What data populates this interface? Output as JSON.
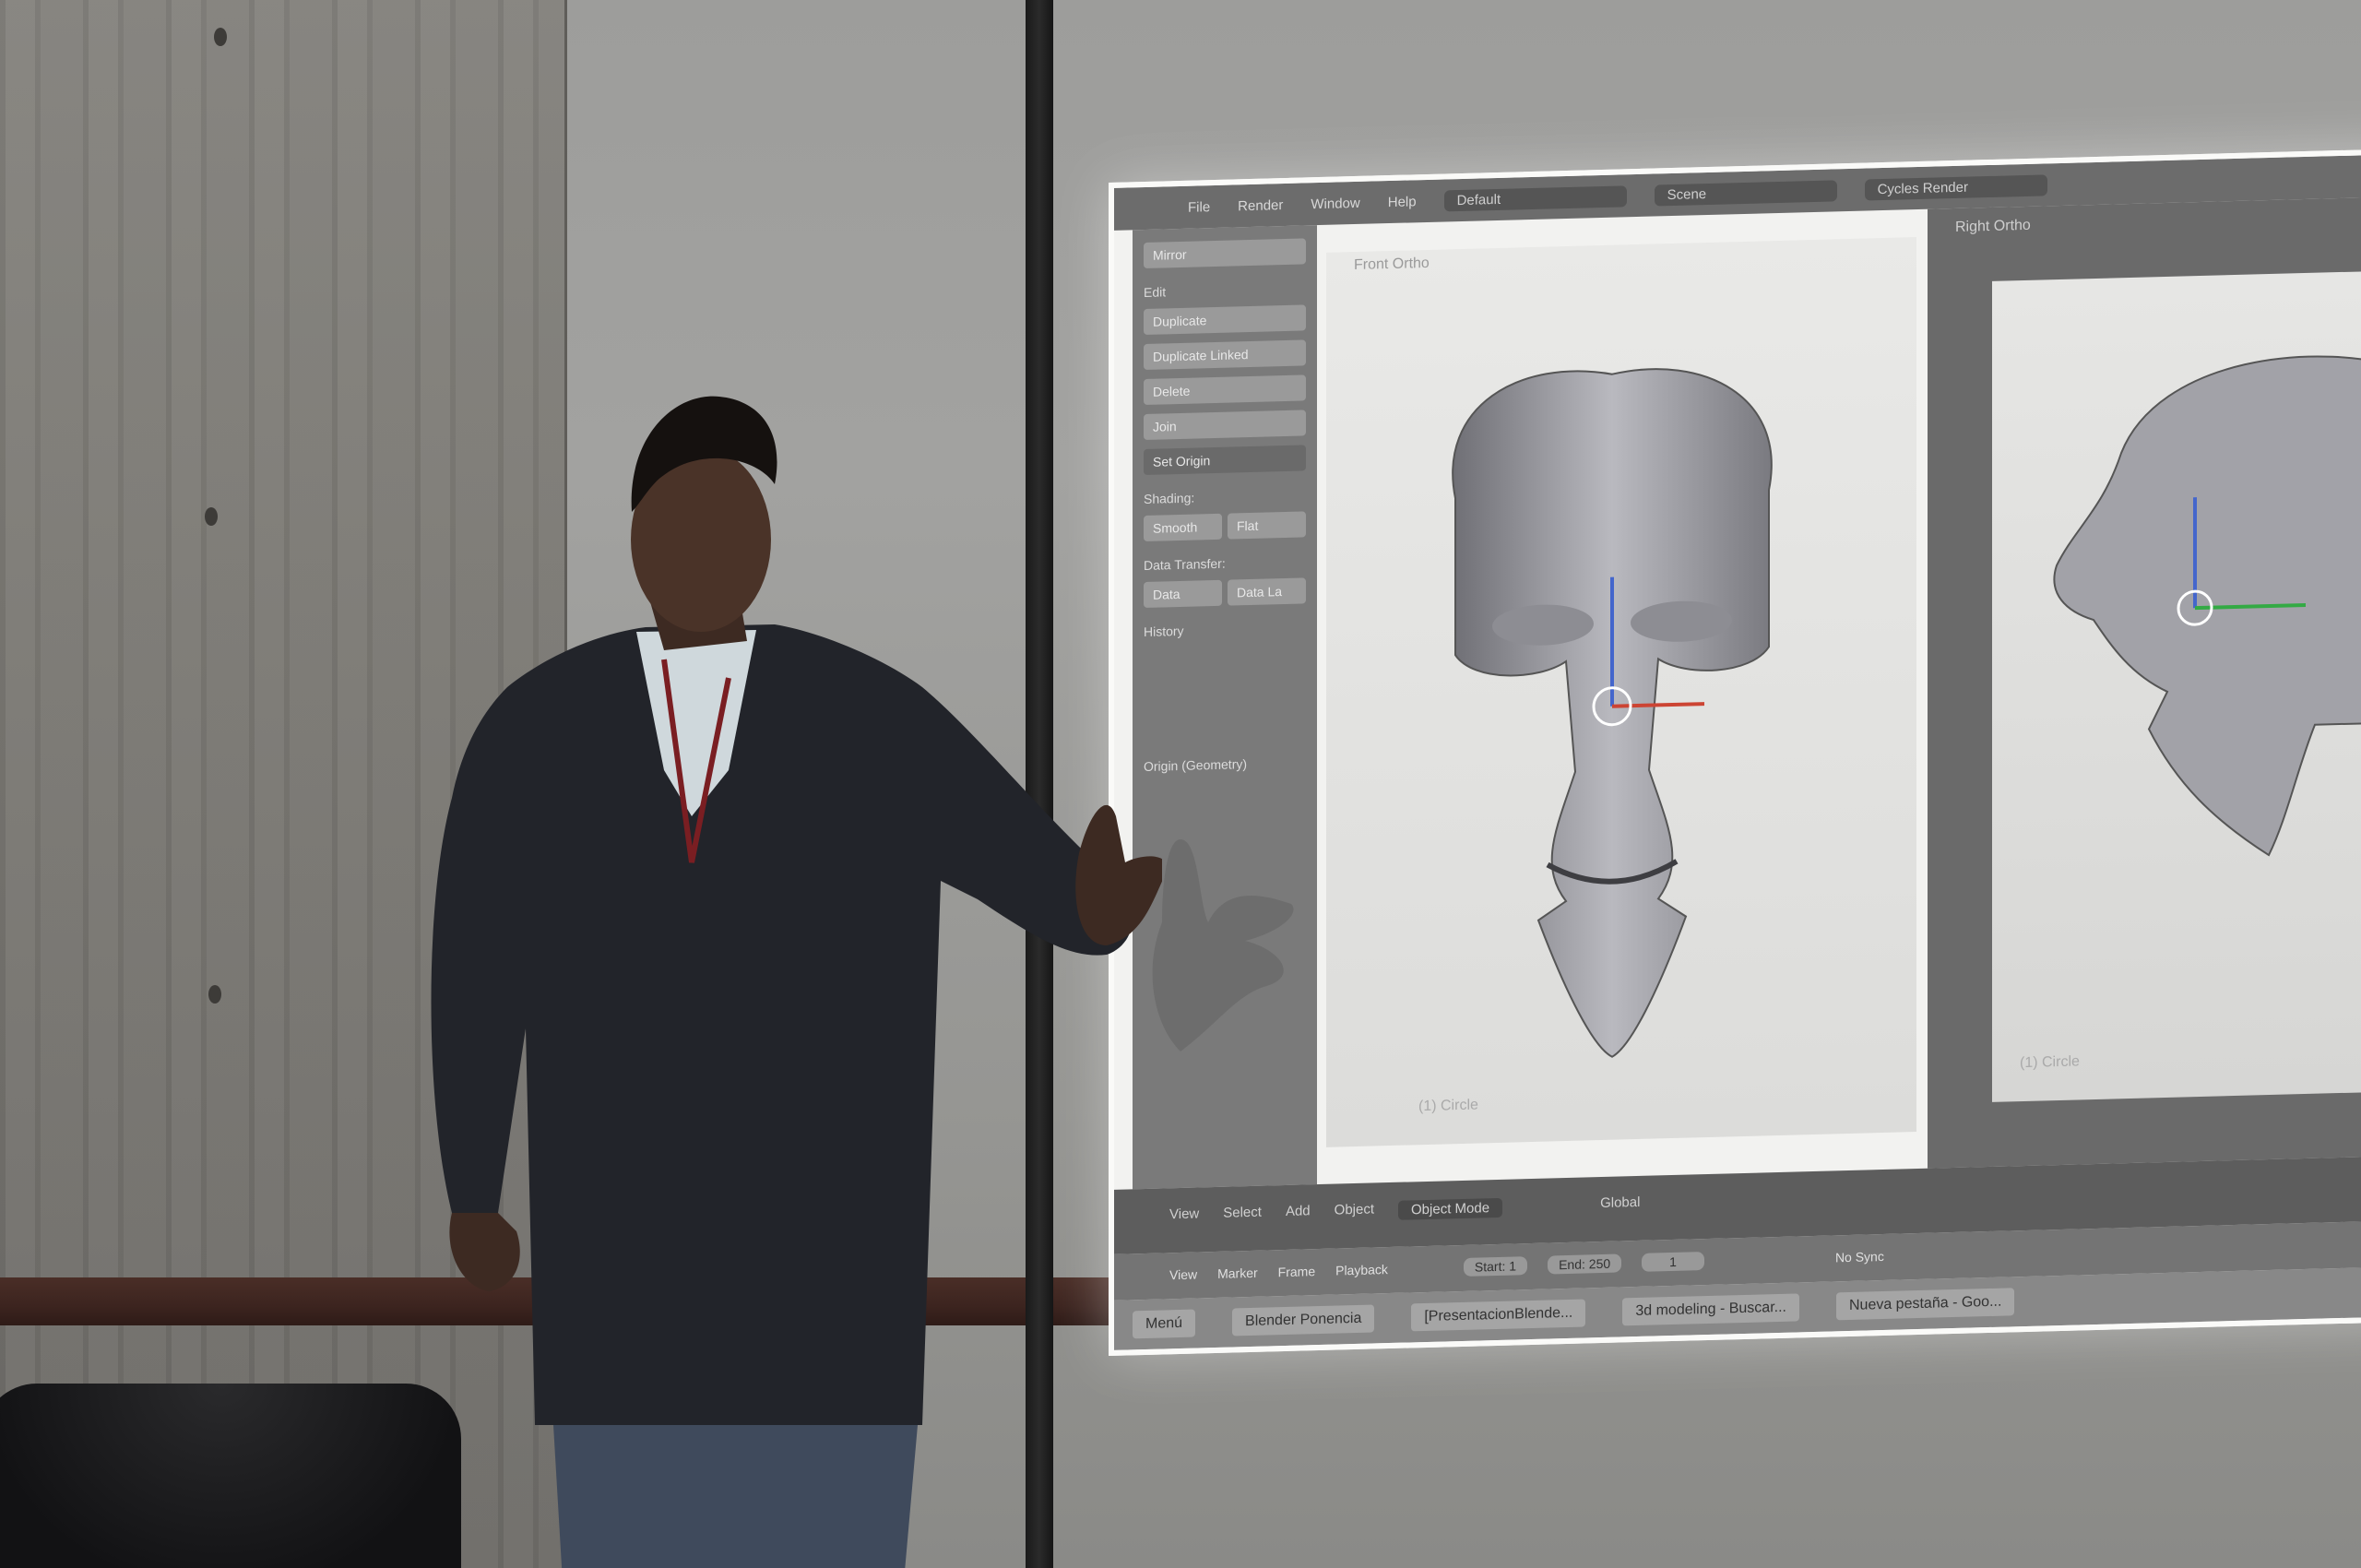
{
  "screen": {
    "menubar": {
      "items": [
        "File",
        "Render",
        "Window",
        "Help"
      ],
      "layout_field": "Default",
      "scene_field": "Scene",
      "engine_field": "Cycles Render"
    },
    "tool_panel": {
      "top_label": "Mirror",
      "edit_header": "Edit",
      "buttons": [
        "Duplicate",
        "Duplicate Linked",
        "Delete",
        "Join",
        "Set Origin"
      ],
      "shading_header": "Shading:",
      "shading_buttons": [
        "Smooth",
        "Flat"
      ],
      "data_transfer_header": "Data Transfer:",
      "data_buttons": [
        "Data",
        "Data La"
      ],
      "history_header": "History",
      "footer_label": "Origin (Geometry)"
    },
    "viewports": {
      "front_label": "Front Ortho",
      "front_footer": "(1) Circle",
      "right_label": "Right Ortho",
      "right_footer": "(1) Circle"
    },
    "header_bar": {
      "items": [
        "View",
        "Select",
        "Add",
        "Object"
      ],
      "mode": "Object Mode",
      "orientation": "Global"
    },
    "timeline": {
      "items": [
        "View",
        "Marker",
        "Frame",
        "Playback"
      ],
      "start": "Start:",
      "start_value": "1",
      "end": "End:",
      "end_value": "250",
      "current": "1",
      "sync": "No Sync"
    },
    "taskbar": {
      "items": [
        "Menú",
        "Blender Ponencia",
        "[PresentacionBlende...",
        "3d modeling - Buscar...",
        "Nueva pestaña - Goo..."
      ]
    }
  }
}
